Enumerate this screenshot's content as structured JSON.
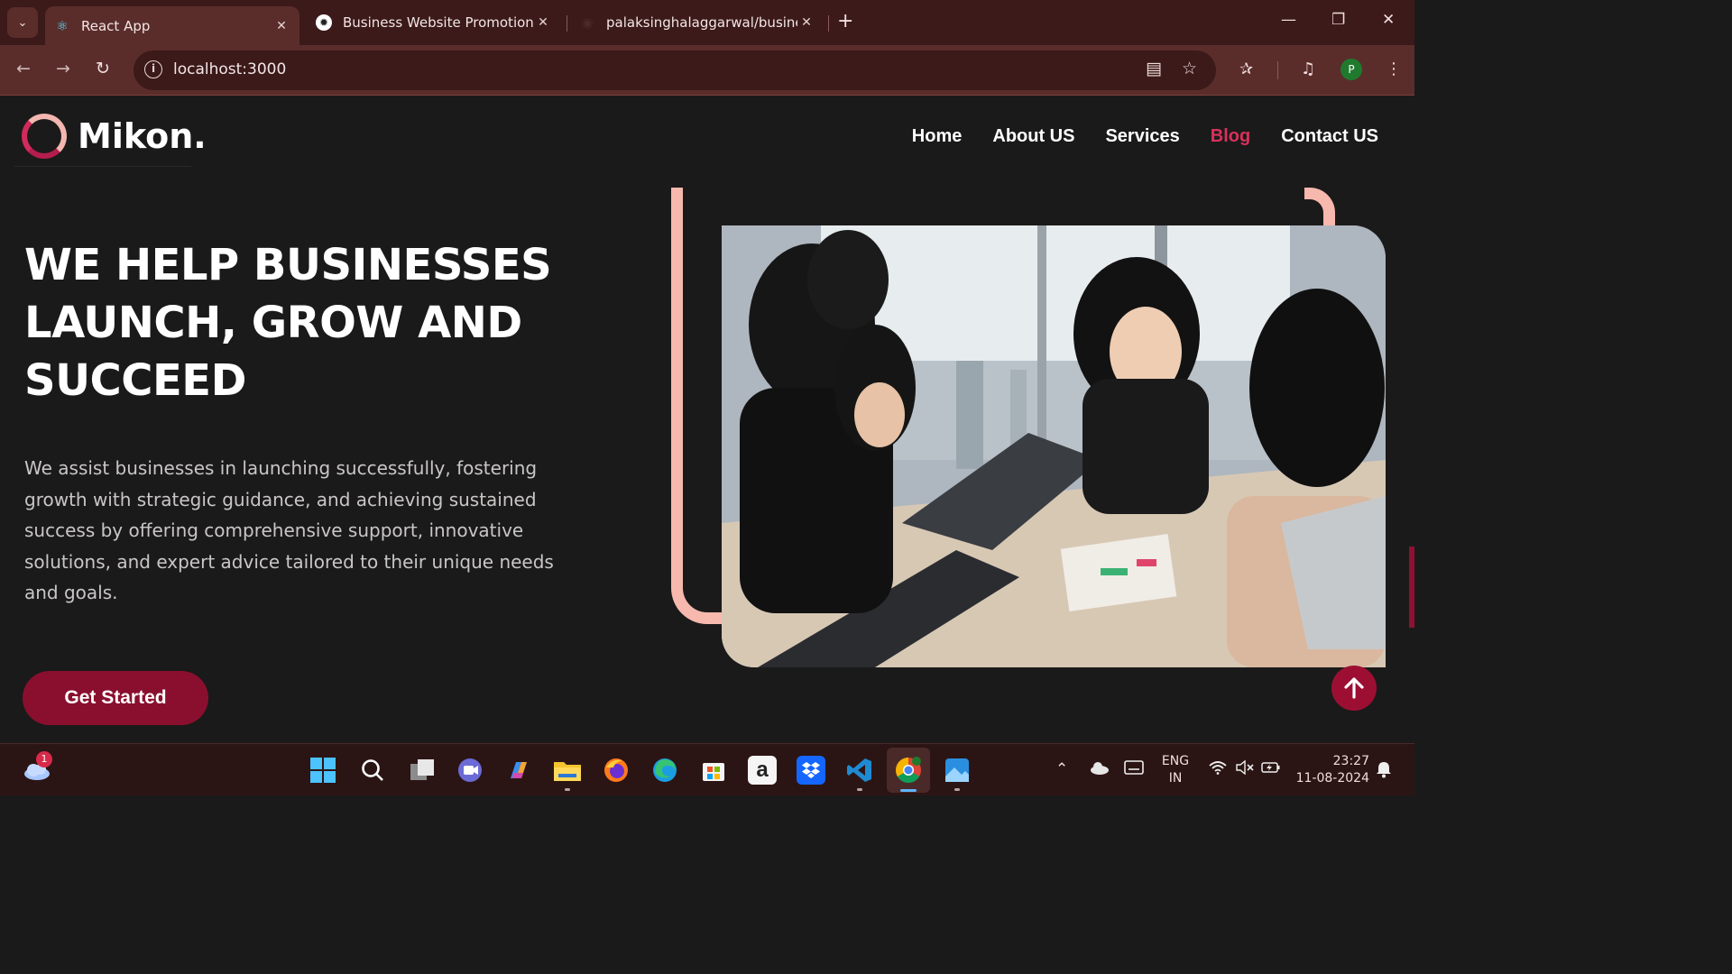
{
  "browser": {
    "tabs": [
      {
        "label": "React App",
        "active": true
      },
      {
        "label": "Business Website Promotion",
        "active": false
      },
      {
        "label": "palaksinghalaggarwal/business",
        "active": false
      }
    ],
    "url": "localhost:3000",
    "profile_initial": "P"
  },
  "site": {
    "logo_text": "Mikon.",
    "nav": [
      "Home",
      "About US",
      "Services",
      "Blog",
      "Contact US"
    ],
    "active_nav": "Blog",
    "hero_title": "WE HELP BUSINESSES LAUNCH, GROW AND SUCCEED",
    "hero_description": "We assist businesses in launching successfully, fostering growth with strategic guidance, and achieving sustained success by offering comprehensive support, innovative solutions, and expert advice tailored to their unique needs and goals.",
    "cta_label": "Get Started",
    "accent_color": "#8a0f2e",
    "highlight_color": "#d8315b",
    "frame_color": "#f7b8ae"
  },
  "taskbar": {
    "weather_badge": "1",
    "language": "ENG",
    "region": "IN",
    "time": "23:27",
    "date": "11-08-2024",
    "apps": [
      "start-icon",
      "search-icon",
      "task-view-icon",
      "meet-icon",
      "copilot-icon",
      "file-explorer-icon",
      "firefox-icon",
      "edge-icon",
      "store-icon",
      "amazon-icon",
      "dropbox-icon",
      "vscode-icon",
      "chrome-icon",
      "photos-icon"
    ]
  }
}
